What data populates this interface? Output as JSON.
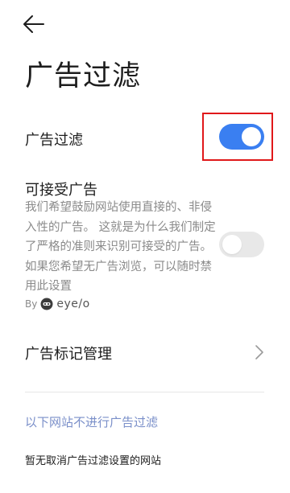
{
  "header": {
    "back_icon": "arrow-left-icon",
    "title": "广告过滤"
  },
  "ad_filter": {
    "label": "广告过滤",
    "enabled": true,
    "accent_color": "#3a7ff1"
  },
  "acceptable_ads": {
    "title": "可接受广告",
    "description": "我们希望鼓励网站使用直接的、非侵入性的广告。 这就是为什么我们制定了严格的准则来识别可接受的广告。 如果您希望无广告浏览，可以随时禁用此设置",
    "enabled": false,
    "by_label": "By",
    "provider": "eye/o"
  },
  "ad_mark_management": {
    "label": "广告标记管理",
    "chevron_icon": "chevron-right-icon"
  },
  "whitelist": {
    "header": "以下网站不进行广告过滤",
    "empty_text": "暂无取消广告过滤设置的网站"
  }
}
